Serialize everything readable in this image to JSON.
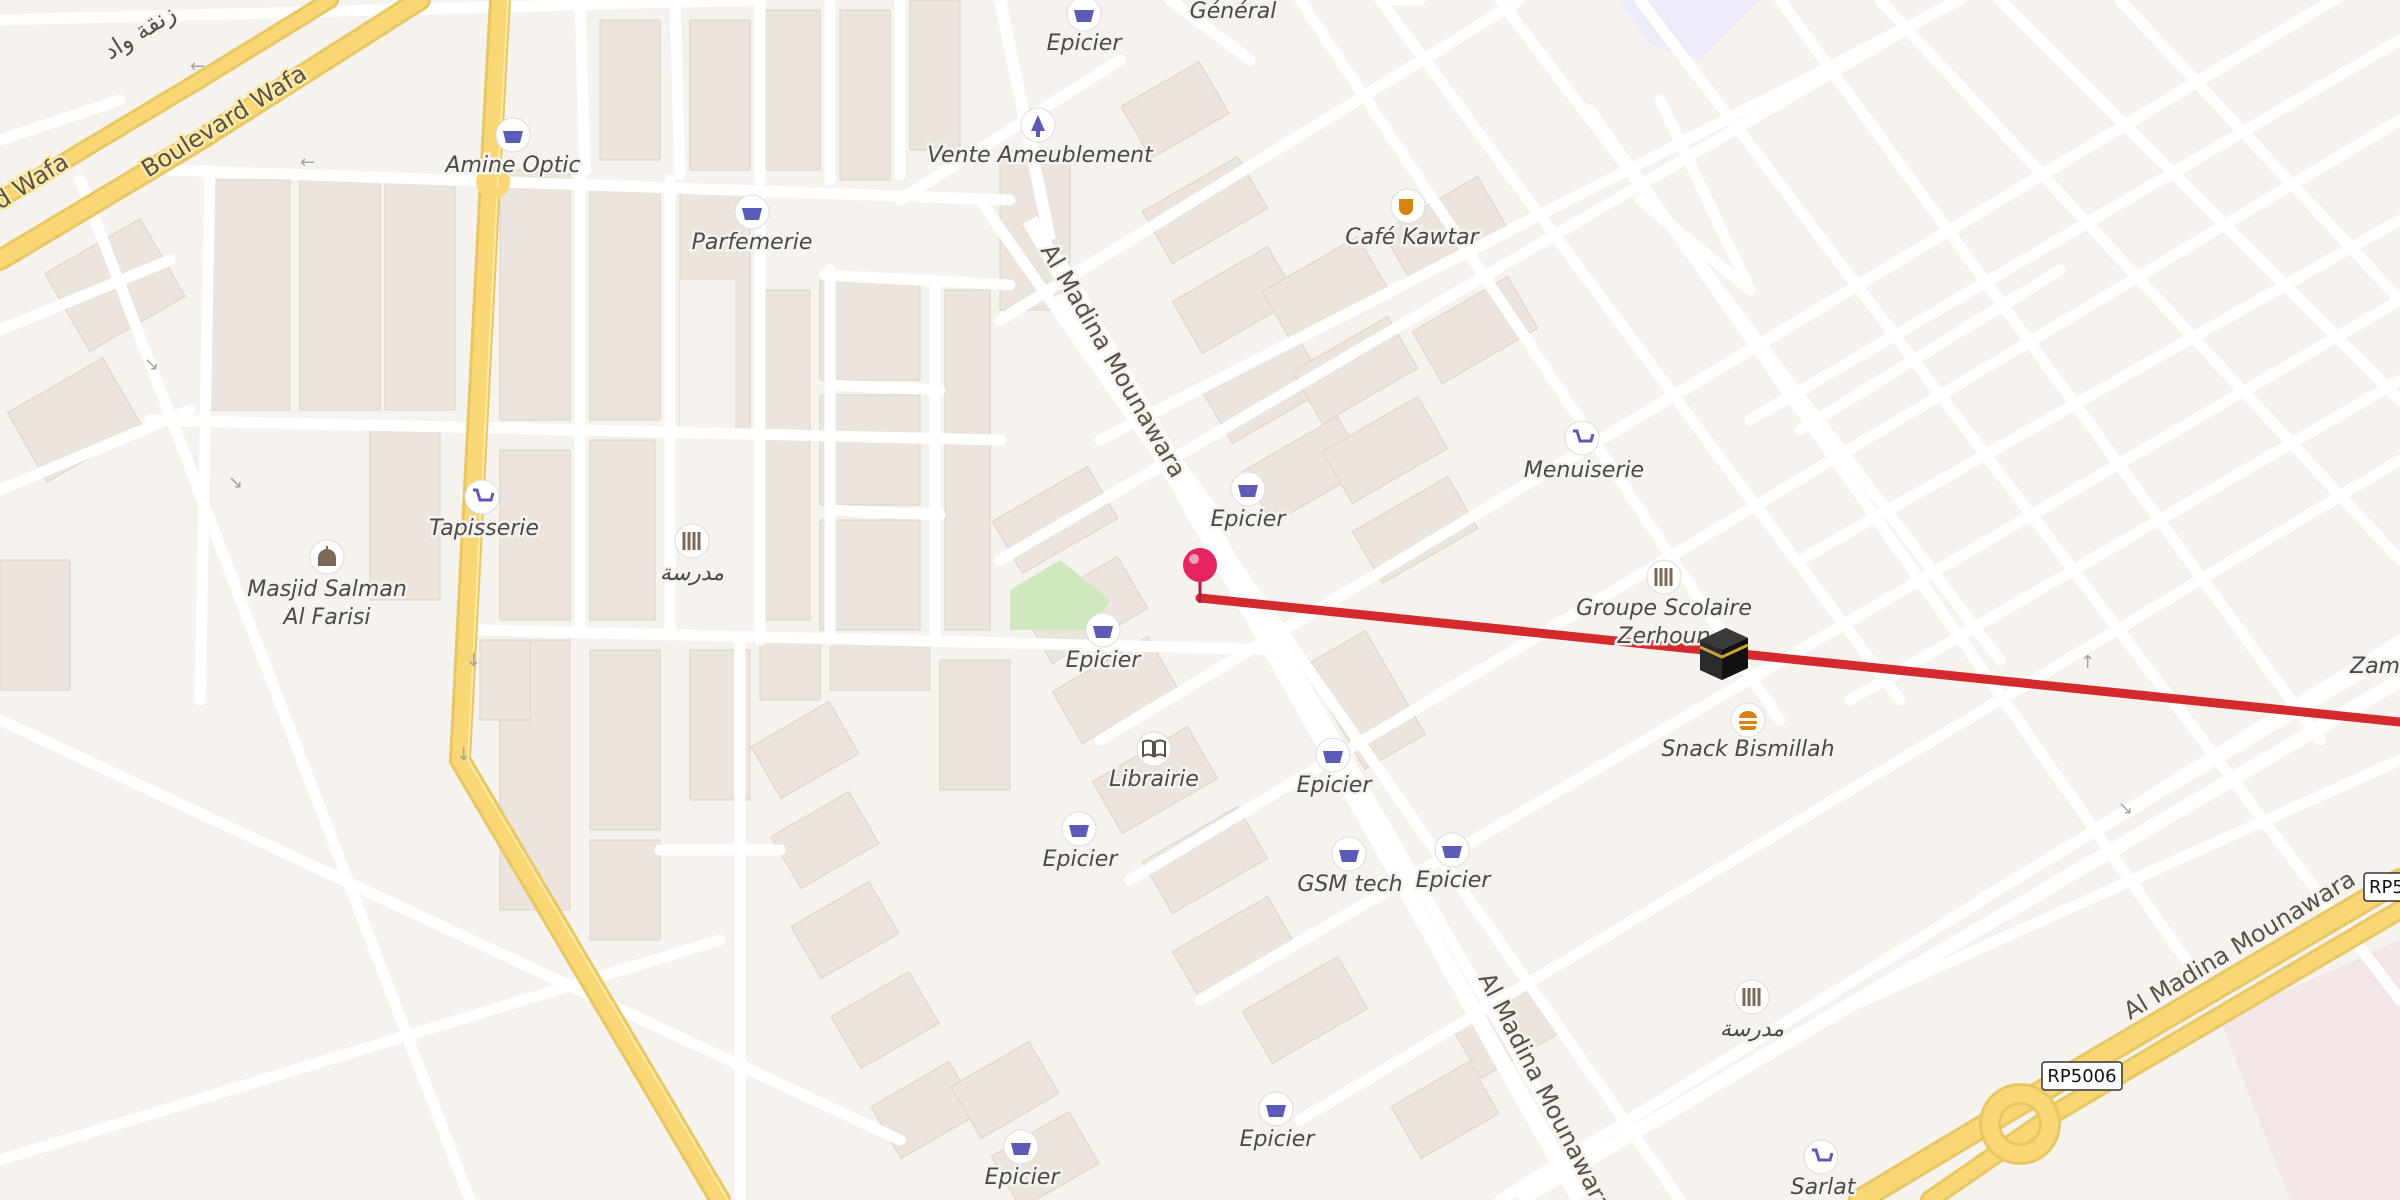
{
  "map": {
    "route_color": "#d42a2e",
    "pin_color": "#e5245f",
    "poi_color": "#5c5bb8",
    "cafe_color": "#d9820f",
    "snack_color": "#d9820f",
    "major_road_color": "#f8d774",
    "minor_road_color": "#ffffff",
    "block_color": "#ece5dd",
    "park_color": "#cfe8bd"
  },
  "roads": {
    "boulevard_wafa": "Boulevard Wafa",
    "wafa_partial": "d Wafa",
    "arabic_fragment": "زنقة واد",
    "al_madina_north": "Al Madina Mounawara",
    "al_madina_south": "Al Madina Mounawara",
    "al_madina_east": "Al Madina Mounawara",
    "shield_rp5006": "RP5006",
    "shield_rp_edge": "RP5"
  },
  "pois": {
    "epicier_top": "Epicier",
    "general": "Général",
    "vente_ameublement": "Vente Ameublement",
    "amine_optic": "Amine Optic",
    "parfemerie": "Parfemerie",
    "cafe_kawtar": "Café Kawtar",
    "menuiserie": "Menuiserie",
    "epicier_mid": "Epicier",
    "tapisserie": "Tapisserie",
    "masjid_line1": "Masjid Salman",
    "masjid_line2": "Al Farisi",
    "school_arabic_1": "مدرسة",
    "groupe_scolaire_line1": "Groupe Scolaire",
    "groupe_scolaire_line2": "Zerhoun",
    "epicier_center": "Epicier",
    "zam_partial": "Zam",
    "snack_bismillah": "Snack Bismillah",
    "librairie": "Librairie",
    "epicier_librairie_east": "Epicier",
    "epicier_sw": "Epicier",
    "gsm_tech": "GSM tech",
    "epicier_gsm_east": "Epicier",
    "school_arabic_2": "مدرسة",
    "epicier_bottom": "Epicier",
    "epicier_bottom_left": "Epicier",
    "sarlat": "Sarlat"
  }
}
